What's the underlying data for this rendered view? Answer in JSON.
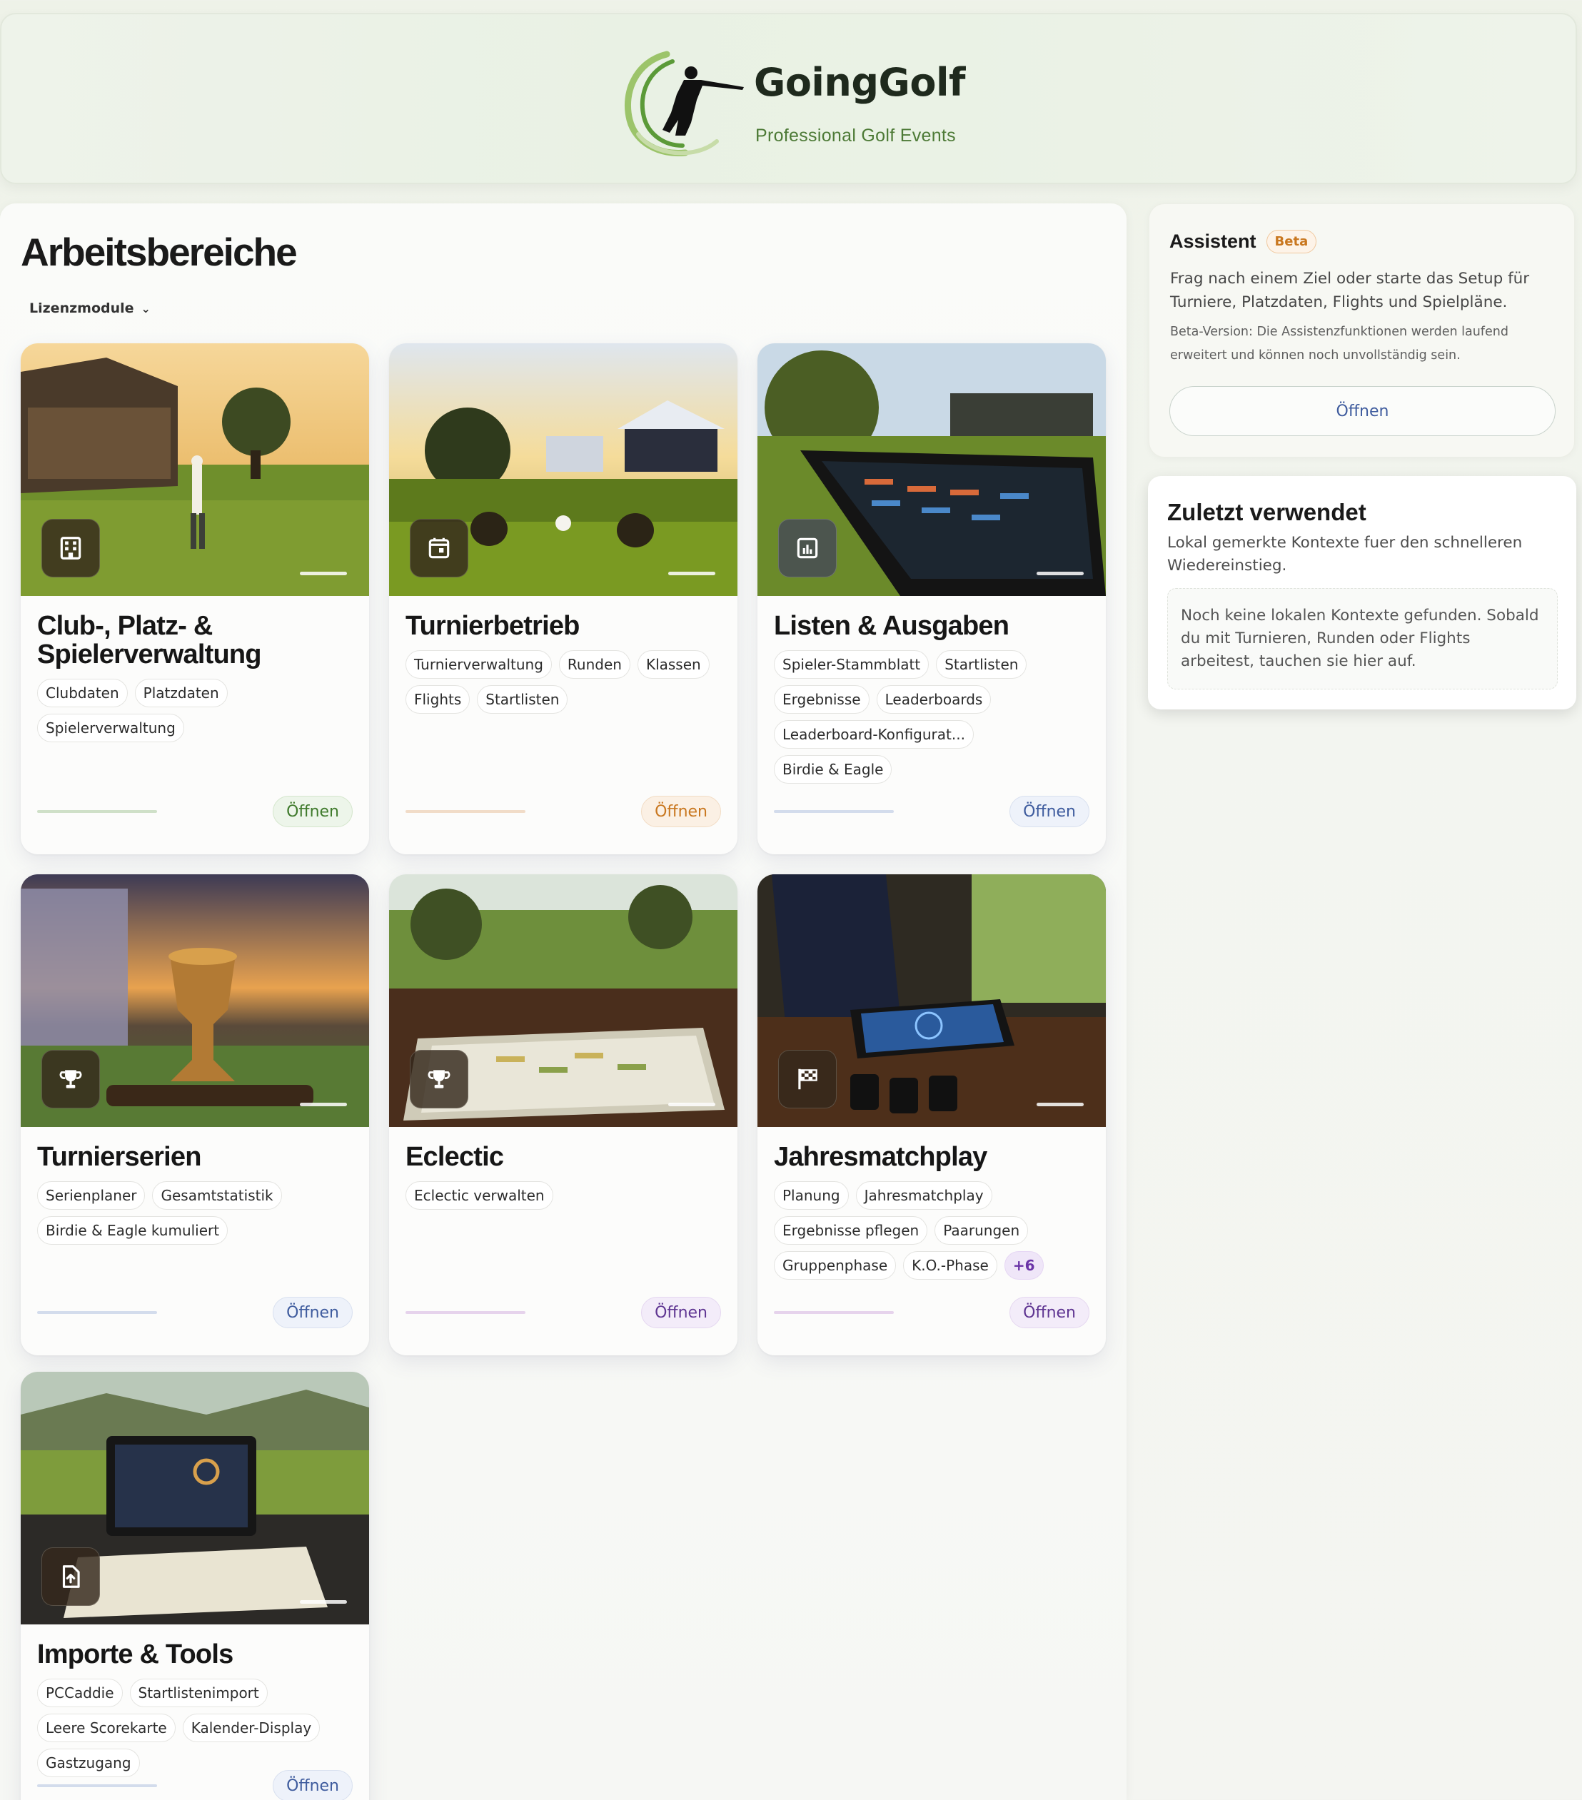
{
  "brand": {
    "name": "GoingGolf",
    "tagline": "Professional Golf Events"
  },
  "main": {
    "title": "Arbeitsbereiche",
    "filter_label": "Lizenzmodule"
  },
  "cards": [
    {
      "title": "Club-, Platz- & Spielerverwaltung",
      "icon": "building-icon",
      "accent": "#3f7a2c",
      "chips": [
        "Clubdaten",
        "Platzdaten",
        "Spielerverwaltung"
      ],
      "open_label": "Öffnen"
    },
    {
      "title": "Turnierbetrieb",
      "icon": "calendar-icon",
      "accent": "#c9771f",
      "chips": [
        "Turnierverwaltung",
        "Runden",
        "Klassen",
        "Flights",
        "Startlisten"
      ],
      "open_label": "Öffnen"
    },
    {
      "title": "Listen & Ausgaben",
      "icon": "bar-chart-icon",
      "accent": "#3f5c9e",
      "chips": [
        "Spieler-Stammblatt",
        "Startlisten",
        "Ergebnisse",
        "Leaderboards",
        "Leaderboard-Konfigurat...",
        "Birdie & Eagle"
      ],
      "open_label": "Öffnen"
    },
    {
      "title": "Turnierserien",
      "icon": "trophy-icon",
      "accent": "#3f5c9e",
      "chips": [
        "Serienplaner",
        "Gesamtstatistik",
        "Birdie & Eagle kumuliert"
      ],
      "open_label": "Öffnen"
    },
    {
      "title": "Eclectic",
      "icon": "trophy-icon",
      "accent": "#5f3592",
      "chips": [
        "Eclectic verwalten"
      ],
      "open_label": "Öffnen"
    },
    {
      "title": "Jahresmatchplay",
      "icon": "checkered-flag-icon",
      "accent": "#5f3592",
      "chips": [
        "Planung",
        "Jahresmatchplay",
        "Ergebnisse pflegen",
        "Paarungen",
        "Gruppenphase",
        "K.O.-Phase"
      ],
      "more": "+6",
      "open_label": "Öffnen"
    },
    {
      "title": "Importe & Tools",
      "icon": "file-upload-icon",
      "accent": "#3f5c9e",
      "chips": [
        "PCCaddie",
        "Startlistenimport",
        "Leere Scorekarte",
        "Kalender-Display",
        "Gastzugang"
      ],
      "open_label": "Öffnen"
    }
  ],
  "assistant": {
    "title": "Assistent",
    "badge": "Beta",
    "description": "Frag nach einem Ziel oder starte das Setup für Turniere, Platzdaten, Flights und Spielpläne.",
    "note": "Beta-Version: Die Assistenzfunktionen werden laufend erweitert und können noch unvollständig sein.",
    "open_label": "Öffnen"
  },
  "recent": {
    "title": "Zuletzt verwendet",
    "description": "Lokal gemerkte Kontexte fuer den schnelleren Wiedereinstieg.",
    "empty_text": "Noch keine lokalen Kontexte gefunden. Sobald du mit Turnieren, Runden oder Flights arbeitest, tauchen sie hier auf."
  }
}
